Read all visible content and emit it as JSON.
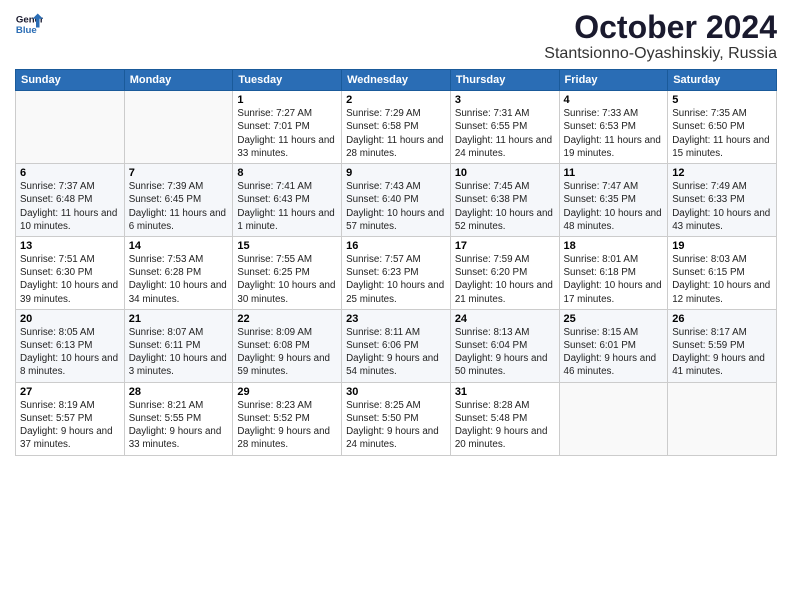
{
  "logo": {
    "line1": "General",
    "line2": "Blue"
  },
  "title": "October 2024",
  "subtitle": "Stantsionno-Oyashinskiy, Russia",
  "days_of_week": [
    "Sunday",
    "Monday",
    "Tuesday",
    "Wednesday",
    "Thursday",
    "Friday",
    "Saturday"
  ],
  "weeks": [
    [
      {
        "day": "",
        "sunrise": "",
        "sunset": "",
        "daylight": ""
      },
      {
        "day": "",
        "sunrise": "",
        "sunset": "",
        "daylight": ""
      },
      {
        "day": "1",
        "sunrise": "Sunrise: 7:27 AM",
        "sunset": "Sunset: 7:01 PM",
        "daylight": "Daylight: 11 hours and 33 minutes."
      },
      {
        "day": "2",
        "sunrise": "Sunrise: 7:29 AM",
        "sunset": "Sunset: 6:58 PM",
        "daylight": "Daylight: 11 hours and 28 minutes."
      },
      {
        "day": "3",
        "sunrise": "Sunrise: 7:31 AM",
        "sunset": "Sunset: 6:55 PM",
        "daylight": "Daylight: 11 hours and 24 minutes."
      },
      {
        "day": "4",
        "sunrise": "Sunrise: 7:33 AM",
        "sunset": "Sunset: 6:53 PM",
        "daylight": "Daylight: 11 hours and 19 minutes."
      },
      {
        "day": "5",
        "sunrise": "Sunrise: 7:35 AM",
        "sunset": "Sunset: 6:50 PM",
        "daylight": "Daylight: 11 hours and 15 minutes."
      }
    ],
    [
      {
        "day": "6",
        "sunrise": "Sunrise: 7:37 AM",
        "sunset": "Sunset: 6:48 PM",
        "daylight": "Daylight: 11 hours and 10 minutes."
      },
      {
        "day": "7",
        "sunrise": "Sunrise: 7:39 AM",
        "sunset": "Sunset: 6:45 PM",
        "daylight": "Daylight: 11 hours and 6 minutes."
      },
      {
        "day": "8",
        "sunrise": "Sunrise: 7:41 AM",
        "sunset": "Sunset: 6:43 PM",
        "daylight": "Daylight: 11 hours and 1 minute."
      },
      {
        "day": "9",
        "sunrise": "Sunrise: 7:43 AM",
        "sunset": "Sunset: 6:40 PM",
        "daylight": "Daylight: 10 hours and 57 minutes."
      },
      {
        "day": "10",
        "sunrise": "Sunrise: 7:45 AM",
        "sunset": "Sunset: 6:38 PM",
        "daylight": "Daylight: 10 hours and 52 minutes."
      },
      {
        "day": "11",
        "sunrise": "Sunrise: 7:47 AM",
        "sunset": "Sunset: 6:35 PM",
        "daylight": "Daylight: 10 hours and 48 minutes."
      },
      {
        "day": "12",
        "sunrise": "Sunrise: 7:49 AM",
        "sunset": "Sunset: 6:33 PM",
        "daylight": "Daylight: 10 hours and 43 minutes."
      }
    ],
    [
      {
        "day": "13",
        "sunrise": "Sunrise: 7:51 AM",
        "sunset": "Sunset: 6:30 PM",
        "daylight": "Daylight: 10 hours and 39 minutes."
      },
      {
        "day": "14",
        "sunrise": "Sunrise: 7:53 AM",
        "sunset": "Sunset: 6:28 PM",
        "daylight": "Daylight: 10 hours and 34 minutes."
      },
      {
        "day": "15",
        "sunrise": "Sunrise: 7:55 AM",
        "sunset": "Sunset: 6:25 PM",
        "daylight": "Daylight: 10 hours and 30 minutes."
      },
      {
        "day": "16",
        "sunrise": "Sunrise: 7:57 AM",
        "sunset": "Sunset: 6:23 PM",
        "daylight": "Daylight: 10 hours and 25 minutes."
      },
      {
        "day": "17",
        "sunrise": "Sunrise: 7:59 AM",
        "sunset": "Sunset: 6:20 PM",
        "daylight": "Daylight: 10 hours and 21 minutes."
      },
      {
        "day": "18",
        "sunrise": "Sunrise: 8:01 AM",
        "sunset": "Sunset: 6:18 PM",
        "daylight": "Daylight: 10 hours and 17 minutes."
      },
      {
        "day": "19",
        "sunrise": "Sunrise: 8:03 AM",
        "sunset": "Sunset: 6:15 PM",
        "daylight": "Daylight: 10 hours and 12 minutes."
      }
    ],
    [
      {
        "day": "20",
        "sunrise": "Sunrise: 8:05 AM",
        "sunset": "Sunset: 6:13 PM",
        "daylight": "Daylight: 10 hours and 8 minutes."
      },
      {
        "day": "21",
        "sunrise": "Sunrise: 8:07 AM",
        "sunset": "Sunset: 6:11 PM",
        "daylight": "Daylight: 10 hours and 3 minutes."
      },
      {
        "day": "22",
        "sunrise": "Sunrise: 8:09 AM",
        "sunset": "Sunset: 6:08 PM",
        "daylight": "Daylight: 9 hours and 59 minutes."
      },
      {
        "day": "23",
        "sunrise": "Sunrise: 8:11 AM",
        "sunset": "Sunset: 6:06 PM",
        "daylight": "Daylight: 9 hours and 54 minutes."
      },
      {
        "day": "24",
        "sunrise": "Sunrise: 8:13 AM",
        "sunset": "Sunset: 6:04 PM",
        "daylight": "Daylight: 9 hours and 50 minutes."
      },
      {
        "day": "25",
        "sunrise": "Sunrise: 8:15 AM",
        "sunset": "Sunset: 6:01 PM",
        "daylight": "Daylight: 9 hours and 46 minutes."
      },
      {
        "day": "26",
        "sunrise": "Sunrise: 8:17 AM",
        "sunset": "Sunset: 5:59 PM",
        "daylight": "Daylight: 9 hours and 41 minutes."
      }
    ],
    [
      {
        "day": "27",
        "sunrise": "Sunrise: 8:19 AM",
        "sunset": "Sunset: 5:57 PM",
        "daylight": "Daylight: 9 hours and 37 minutes."
      },
      {
        "day": "28",
        "sunrise": "Sunrise: 8:21 AM",
        "sunset": "Sunset: 5:55 PM",
        "daylight": "Daylight: 9 hours and 33 minutes."
      },
      {
        "day": "29",
        "sunrise": "Sunrise: 8:23 AM",
        "sunset": "Sunset: 5:52 PM",
        "daylight": "Daylight: 9 hours and 28 minutes."
      },
      {
        "day": "30",
        "sunrise": "Sunrise: 8:25 AM",
        "sunset": "Sunset: 5:50 PM",
        "daylight": "Daylight: 9 hours and 24 minutes."
      },
      {
        "day": "31",
        "sunrise": "Sunrise: 8:28 AM",
        "sunset": "Sunset: 5:48 PM",
        "daylight": "Daylight: 9 hours and 20 minutes."
      },
      {
        "day": "",
        "sunrise": "",
        "sunset": "",
        "daylight": ""
      },
      {
        "day": "",
        "sunrise": "",
        "sunset": "",
        "daylight": ""
      }
    ]
  ]
}
